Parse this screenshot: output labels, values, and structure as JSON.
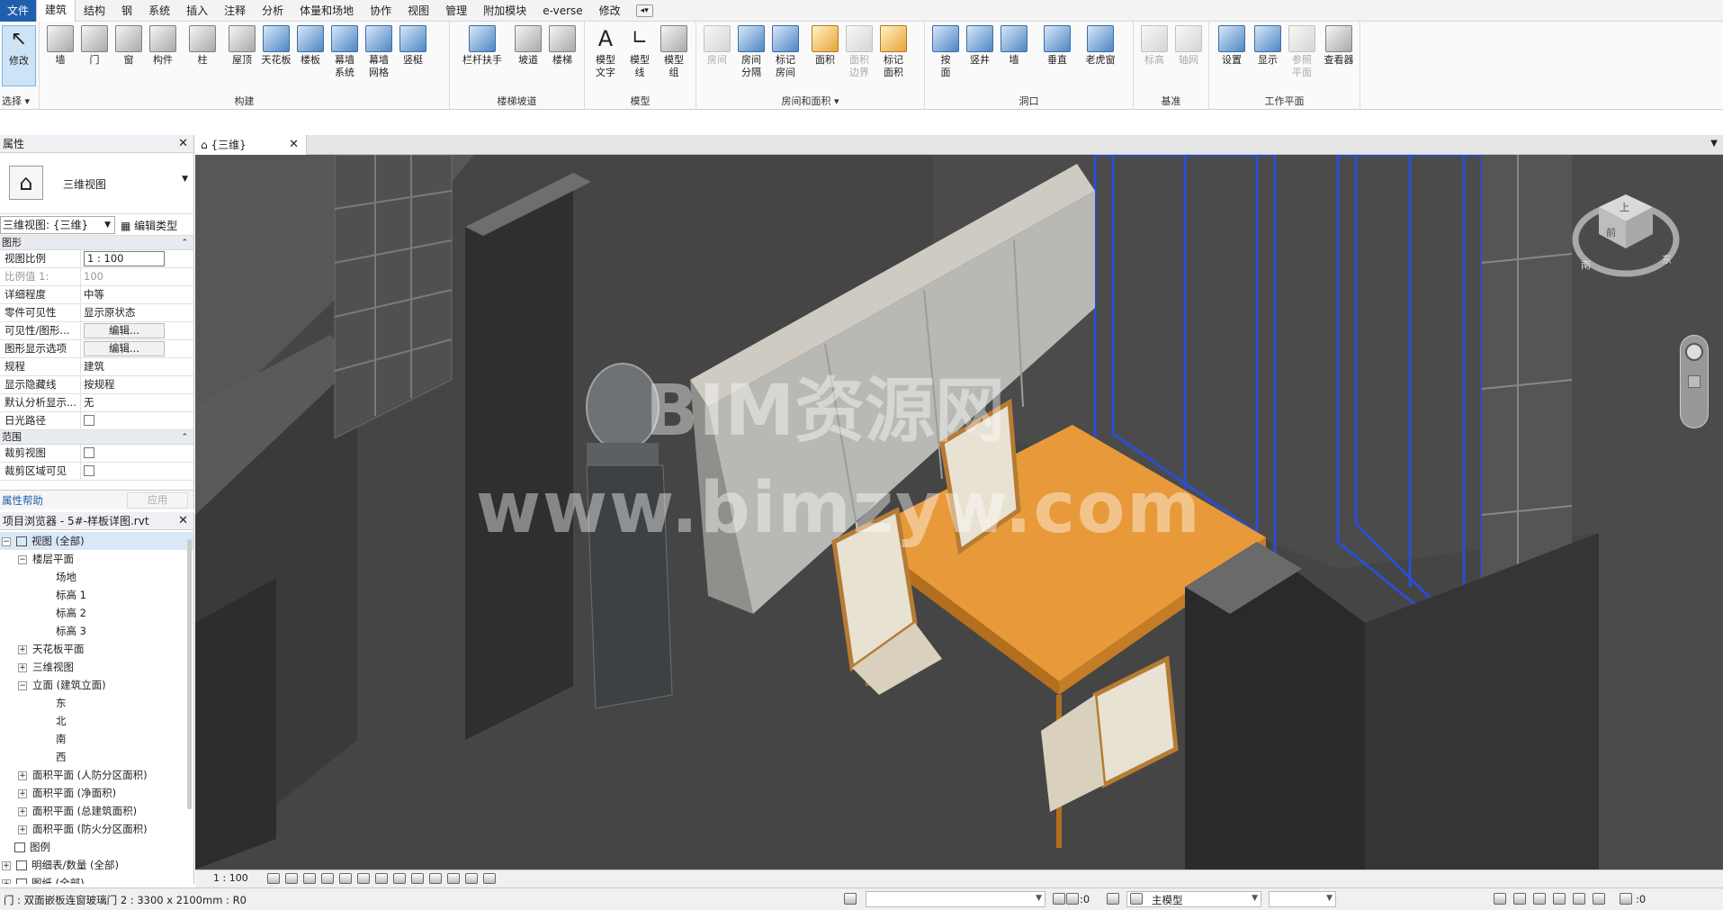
{
  "menu": {
    "file": "文件",
    "items": [
      "建筑",
      "结构",
      "钢",
      "系统",
      "插入",
      "注释",
      "分析",
      "体量和场地",
      "协作",
      "视图",
      "管理",
      "附加模块",
      "e-verse",
      "修改"
    ],
    "active_index": 0
  },
  "ribbon": {
    "groups": {
      "select": "选择",
      "build": "构建",
      "circulation": "楼梯坡道",
      "model": "模型",
      "room_area": "房间和面积",
      "opening": "洞口",
      "datum": "基准",
      "work_plane": "工作平面"
    },
    "buttons": {
      "modify": "修改",
      "wall": "墙",
      "door": "门",
      "window": "窗",
      "component": "构件",
      "column": "柱",
      "roof": "屋顶",
      "ceiling": "天花板",
      "floor": "楼板",
      "curtain_system": "幕墙\n系统",
      "curtain_grid": "幕墙\n网格",
      "mullion": "竖梃",
      "railing": "栏杆扶手",
      "ramp": "坡道",
      "stair": "楼梯",
      "model_text": "模型\n文字",
      "model_line": "模型\n线",
      "model_group": "模型\n组",
      "room": "房间",
      "room_separator": "房间\n分隔",
      "tag_room": "标记\n房间",
      "area": "面积",
      "area_boundary": "面积\n边界",
      "tag_area": "标记\n面积",
      "by_face": "按\n面",
      "shaft": "竖井",
      "wall_opening": "墙",
      "vertical": "垂直",
      "dormer": "老虎窗",
      "level": "标高",
      "grid": "轴网",
      "set": "设置",
      "show": "显示",
      "ref_plane": "参照\n平面",
      "viewer": "查看器"
    }
  },
  "properties": {
    "title": "属性",
    "type_name": "三维视图",
    "selector": "三维视图: {三维}",
    "edit_type": "编辑类型",
    "group_graphics": "图形",
    "rows": [
      {
        "k": "视图比例",
        "v": "1 : 100"
      },
      {
        "k": "比例值 1:",
        "v": "100"
      },
      {
        "k": "详细程度",
        "v": "中等"
      },
      {
        "k": "零件可见性",
        "v": "显示原状态"
      },
      {
        "k": "可见性/图形...",
        "v": "编辑..."
      },
      {
        "k": "图形显示选项",
        "v": "编辑..."
      },
      {
        "k": "规程",
        "v": "建筑"
      },
      {
        "k": "显示隐藏线",
        "v": "按规程"
      },
      {
        "k": "默认分析显示...",
        "v": "无"
      },
      {
        "k": "日光路径",
        "v": ""
      }
    ],
    "group_extents": "范围",
    "rows2": [
      {
        "k": "裁剪视图",
        "v": ""
      },
      {
        "k": "裁剪区域可见",
        "v": ""
      }
    ],
    "help": "属性帮助",
    "apply": "应用"
  },
  "browser": {
    "title": "项目浏览器 - 5#-样板详图.rvt",
    "nodes": [
      "视图 (全部)",
      "楼层平面",
      "场地",
      "标高 1",
      "标高 2",
      "标高 3",
      "天花板平面",
      "三维视图",
      "立面 (建筑立面)",
      "东",
      "北",
      "南",
      "西",
      "面积平面 (人防分区面积)",
      "面积平面 (净面积)",
      "面积平面 (总建筑面积)",
      "面积平面 (防火分区面积)",
      "图例",
      "明细表/数量 (全部)",
      "图纸 (全部)"
    ]
  },
  "view": {
    "tab": "{三维}",
    "watermark_1": "BIM资源网",
    "watermark_2": "www.bimzyw.com",
    "cube_top": "上",
    "cube_front": "前",
    "cube_compass_s": "南",
    "cube_compass_e": "东"
  },
  "viewctl": {
    "scale": "1 : 100"
  },
  "status": {
    "text": "门 : 双面嵌板连窗玻璃门 2 : 3300 x 2100mm : R0",
    "sel_count": ":0",
    "filter_count": ":0",
    "model": "主模型"
  },
  "colors": {
    "file_tab": "#1f5fae",
    "viewport_bg": "#3e3e3e",
    "table_top": "#e89a3a",
    "curtain_blue": "#2a4fd0"
  }
}
